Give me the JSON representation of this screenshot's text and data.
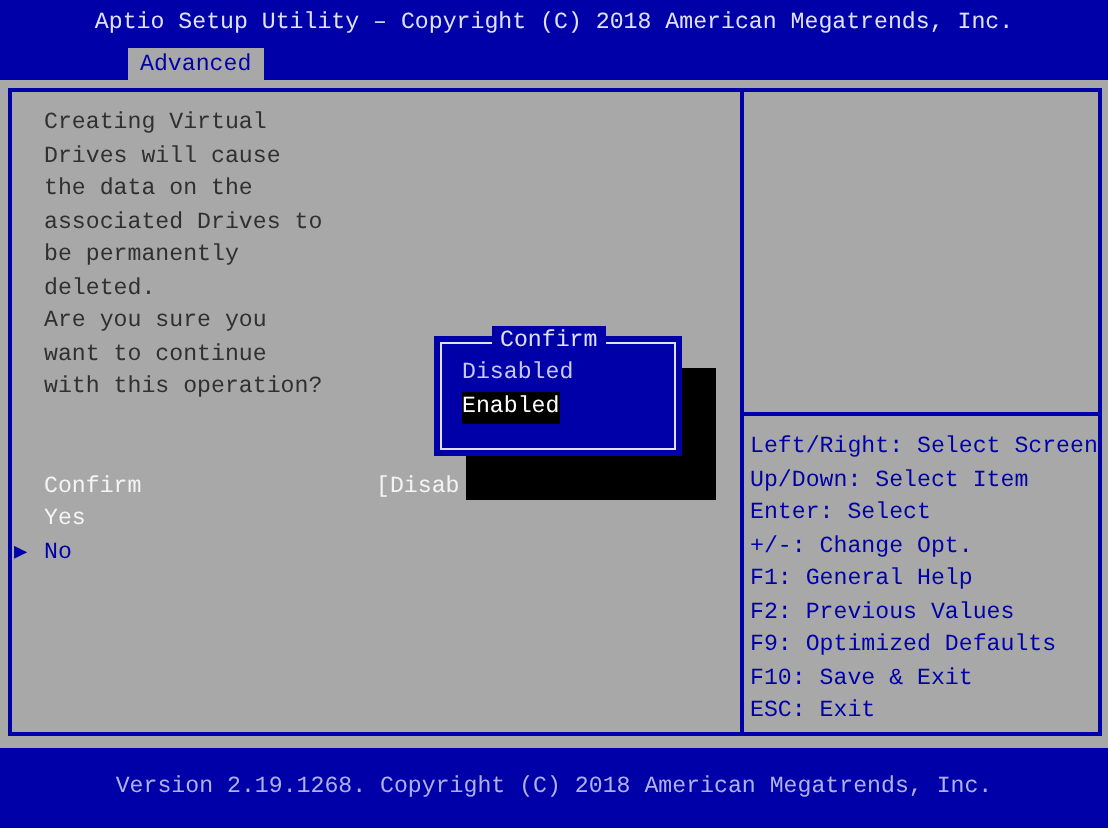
{
  "header": {
    "title": "Aptio Setup Utility – Copyright (C) 2018 American Megatrends, Inc.",
    "tabs": [
      {
        "label": "Advanced",
        "selected": true
      }
    ]
  },
  "message": [
    "Creating Virtual",
    "Drives will cause",
    "the data on the",
    "associated Drives to",
    "be permanently",
    "deleted.",
    "Are you sure you",
    "want to continue",
    "with this operation?"
  ],
  "items": [
    {
      "kind": "option",
      "label": "Confirm",
      "value": "[Disab"
    },
    {
      "kind": "option",
      "label": "Yes"
    },
    {
      "kind": "submenu",
      "marker": "▶",
      "label": "No"
    }
  ],
  "popup": {
    "title": "Confirm",
    "options": [
      {
        "label": "Disabled",
        "selected": false
      },
      {
        "label": "Enabled",
        "selected": true
      }
    ]
  },
  "help": [
    "Left/Right: Select Screen",
    "Up/Down: Select Item",
    "Enter: Select",
    "+/-: Change Opt.",
    "F1: General Help",
    "F2: Previous Values",
    "F9: Optimized Defaults",
    "F10: Save & Exit",
    "ESC: Exit"
  ],
  "footer": "Version 2.19.1268. Copyright (C) 2018 American Megatrends, Inc."
}
